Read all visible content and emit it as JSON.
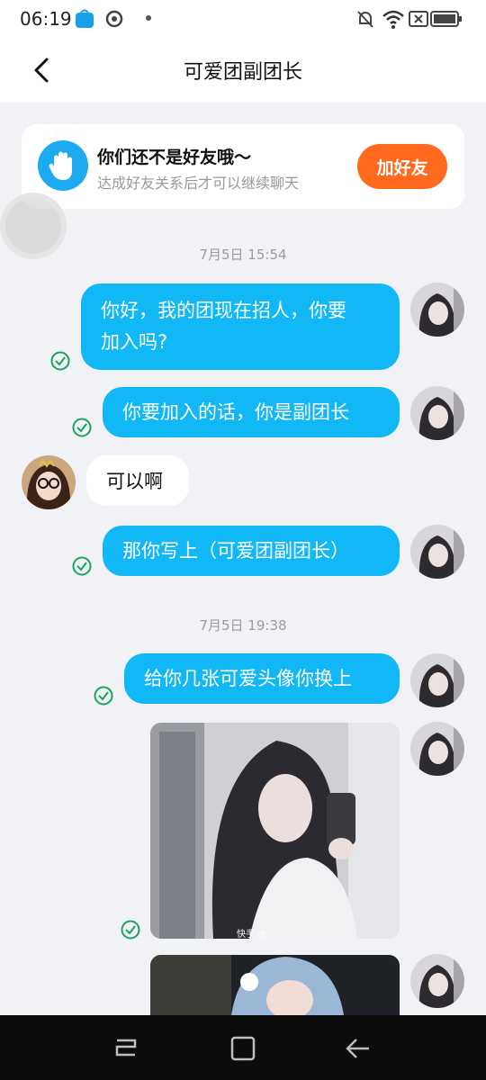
{
  "status": {
    "time": "06:19"
  },
  "header": {
    "title": "可爱团副团长"
  },
  "banner": {
    "title": "你们还不是好友哦～",
    "subtitle": "达成好友关系后才可以继续聊天",
    "button": "加好友"
  },
  "messages": {
    "ts1": "7月5日 15:54",
    "m1_line1": "你好，我的团现在招人，你要",
    "m1_line2": "加入吗?",
    "m2": "你要加入的话，你是副团长",
    "m3": "可以啊",
    "m4": "那你写上（可爱团副团长）",
    "ts2": "7月5日 19:38",
    "m5": "给你几张可爱头像你换上",
    "photo_watermark": "快手 @"
  },
  "colors": {
    "my_bubble": "#12b7f5",
    "add_button": "#ff6a1e",
    "read_check": "#1aa260"
  }
}
